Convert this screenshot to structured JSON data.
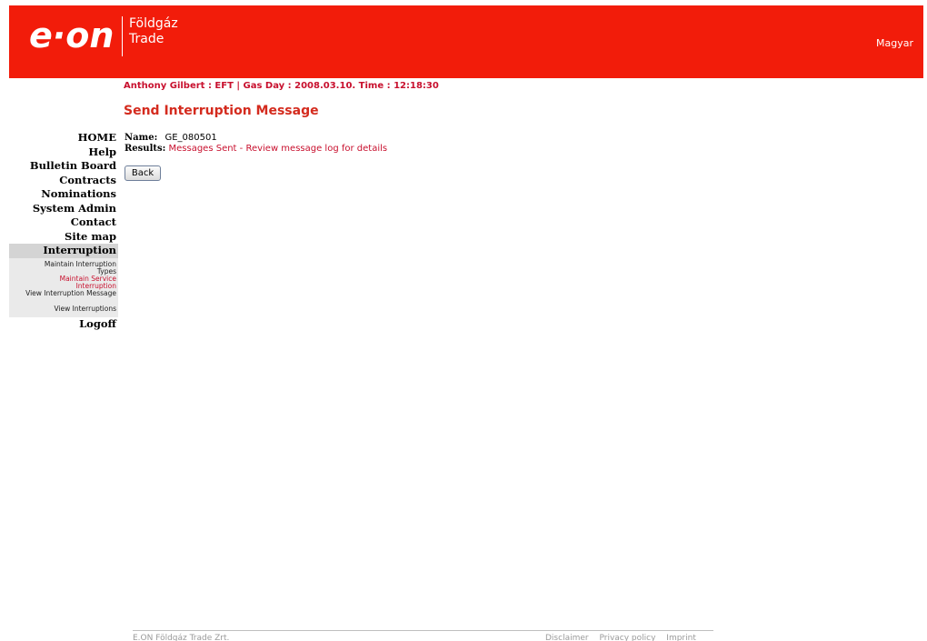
{
  "header": {
    "logo": "e·on",
    "brand_line1": "Földgáz",
    "brand_line2": "Trade",
    "language": "Magyar"
  },
  "status_line": "Anthony Gilbert : EFT | Gas Day : 2008.03.10. Time : 12:18:30",
  "page_title": "Send Interruption Message",
  "nav": {
    "items": [
      "HOME",
      "Help",
      "Bulletin Board",
      "Contracts",
      "Nominations",
      "System Admin",
      "Contact",
      "Site map"
    ],
    "active": "Interruption",
    "sub_items": [
      "Maintain Interruption",
      "Types",
      "Maintain Service",
      "Interruption",
      "View Interruption Message",
      "View Interruptions"
    ],
    "logoff": "Logoff"
  },
  "content": {
    "name_label": "Name:",
    "name_value": "GE_080501",
    "results_label": "Results:",
    "results_value": "Messages Sent - Review message log for details",
    "back_button": "Back"
  },
  "footer": {
    "company": "E.ON Földgáz Trade Zrt.",
    "links": [
      "Disclaimer",
      "Privacy policy",
      "Imprint"
    ]
  },
  "colors": {
    "brand_red": "#f21c0a",
    "link_red": "#c8102e"
  }
}
